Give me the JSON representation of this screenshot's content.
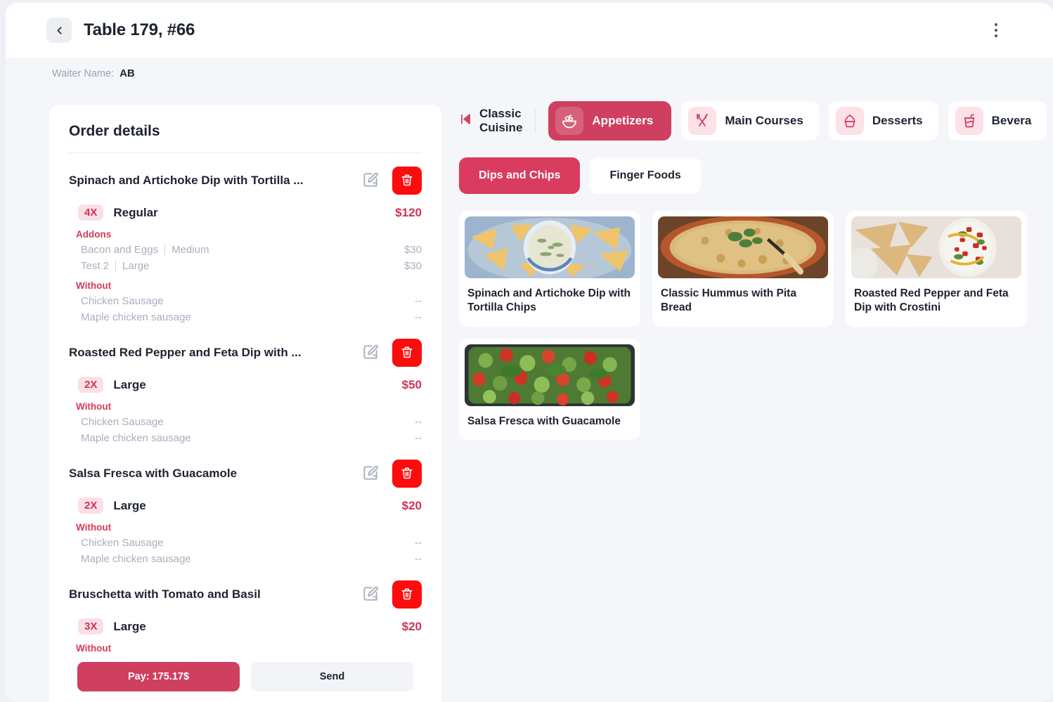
{
  "header": {
    "back_icon": "chevron-left-icon",
    "title": "Table 179, #66",
    "menu_icon": "kebab-menu-icon"
  },
  "waiter": {
    "label": "Waiter Name:",
    "value": "AB"
  },
  "order": {
    "heading": "Order details",
    "addons_label": "Addons",
    "without_label": "Without",
    "items": [
      {
        "name": "Spinach and Artichoke Dip with Tortilla ...",
        "qty": "4X",
        "size": "Regular",
        "price": "$120",
        "addons": [
          {
            "name": "Bacon and Eggs",
            "variant": "Medium",
            "price": "$30"
          },
          {
            "name": "Test 2",
            "variant": "Large",
            "price": "$30"
          }
        ],
        "without": [
          {
            "name": "Chicken Sausage",
            "price": "--"
          },
          {
            "name": "Maple chicken sausage",
            "price": "--"
          }
        ]
      },
      {
        "name": "Roasted Red Pepper and Feta Dip with ...",
        "qty": "2X",
        "size": "Large",
        "price": "$50",
        "addons": [],
        "without": [
          {
            "name": "Chicken Sausage",
            "price": "--"
          },
          {
            "name": "Maple chicken sausage",
            "price": "--"
          }
        ]
      },
      {
        "name": "Salsa Fresca with Guacamole",
        "qty": "2X",
        "size": "Large",
        "price": "$20",
        "addons": [],
        "without": [
          {
            "name": "Chicken Sausage",
            "price": "--"
          },
          {
            "name": "Maple chicken sausage",
            "price": "--"
          }
        ]
      },
      {
        "name": "Bruschetta with Tomato and Basil",
        "qty": "3X",
        "size": "Large",
        "price": "$20",
        "addons": [],
        "without": []
      }
    ],
    "edit_icon": "edit-pencil-icon",
    "delete_icon": "trash-icon"
  },
  "footer": {
    "pay_label": "Pay:  175.17$",
    "send_label": "Send"
  },
  "categories": {
    "classic": {
      "label": "Classic Cuisine",
      "icon": "skip-back-icon"
    },
    "tabs": [
      {
        "label": "Appetizers",
        "icon": "salad-bowl-icon",
        "active": true
      },
      {
        "label": "Main Courses",
        "icon": "fork-knife-cross-icon",
        "active": false
      },
      {
        "label": "Desserts",
        "icon": "cupcake-icon",
        "active": false
      },
      {
        "label": "Bevera",
        "icon": "drink-cup-icon",
        "active": false
      }
    ]
  },
  "subcategories": [
    {
      "label": "Dips and Chips",
      "active": true
    },
    {
      "label": "Finger Foods",
      "active": false
    }
  ],
  "products": [
    {
      "title": "Spinach and Artichoke Dip with Tortilla Chips",
      "image": "spinach-artichoke-dip-photo"
    },
    {
      "title": "Classic Hummus with Pita Bread",
      "image": "classic-hummus-photo"
    },
    {
      "title": "Roasted Red Pepper and Feta Dip with Crostini",
      "image": "red-pepper-feta-dip-photo"
    },
    {
      "title": "Salsa Fresca with Guacamole",
      "image": "salsa-fresca-photo"
    }
  ],
  "colors": {
    "accent": "#cf3f5f",
    "danger": "#fb0d0d",
    "badge_bg": "#fbdfe6",
    "page_bg": "#f4f6fa"
  }
}
